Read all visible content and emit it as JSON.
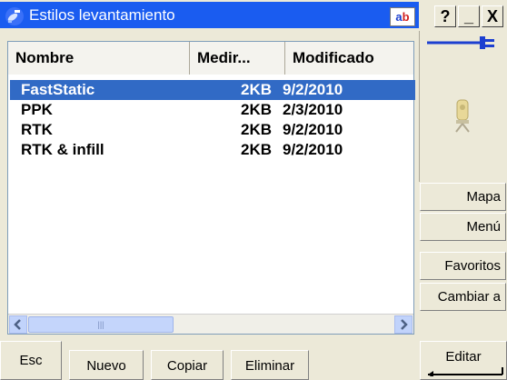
{
  "window": {
    "title": "Estilos levantamiento",
    "ab_a": "a",
    "ab_b": "b",
    "help_label": "?",
    "minimize_label": "_",
    "close_label": "X"
  },
  "list": {
    "columns": [
      "Nombre",
      "Medir...",
      "Modificado"
    ],
    "rows": [
      {
        "name": "FastStatic",
        "size": "2KB",
        "date": "9/2/2010",
        "selected": true
      },
      {
        "name": "PPK",
        "size": "2KB",
        "date": "2/3/2010",
        "selected": false
      },
      {
        "name": "RTK",
        "size": "2KB",
        "date": "9/2/2010",
        "selected": false
      },
      {
        "name": "RTK & infill",
        "size": "2KB",
        "date": "9/2/2010",
        "selected": false
      }
    ],
    "scroll_left_icon": "chevron-left-icon",
    "scroll_right_icon": "chevron-right-icon",
    "thumb_grip": "|||"
  },
  "side_buttons": {
    "mapa": "Mapa",
    "menu": "Menú",
    "favoritos": "Favoritos",
    "cambiar": "Cambiar a"
  },
  "bottom": {
    "esc": "Esc",
    "nuevo": "Nuevo",
    "copiar": "Copiar",
    "eliminar": "Eliminar",
    "editar": "Editar"
  },
  "colors": {
    "title_bar": "#1a5cf0",
    "selection": "#316ac5",
    "panel": "#ece9d8"
  }
}
